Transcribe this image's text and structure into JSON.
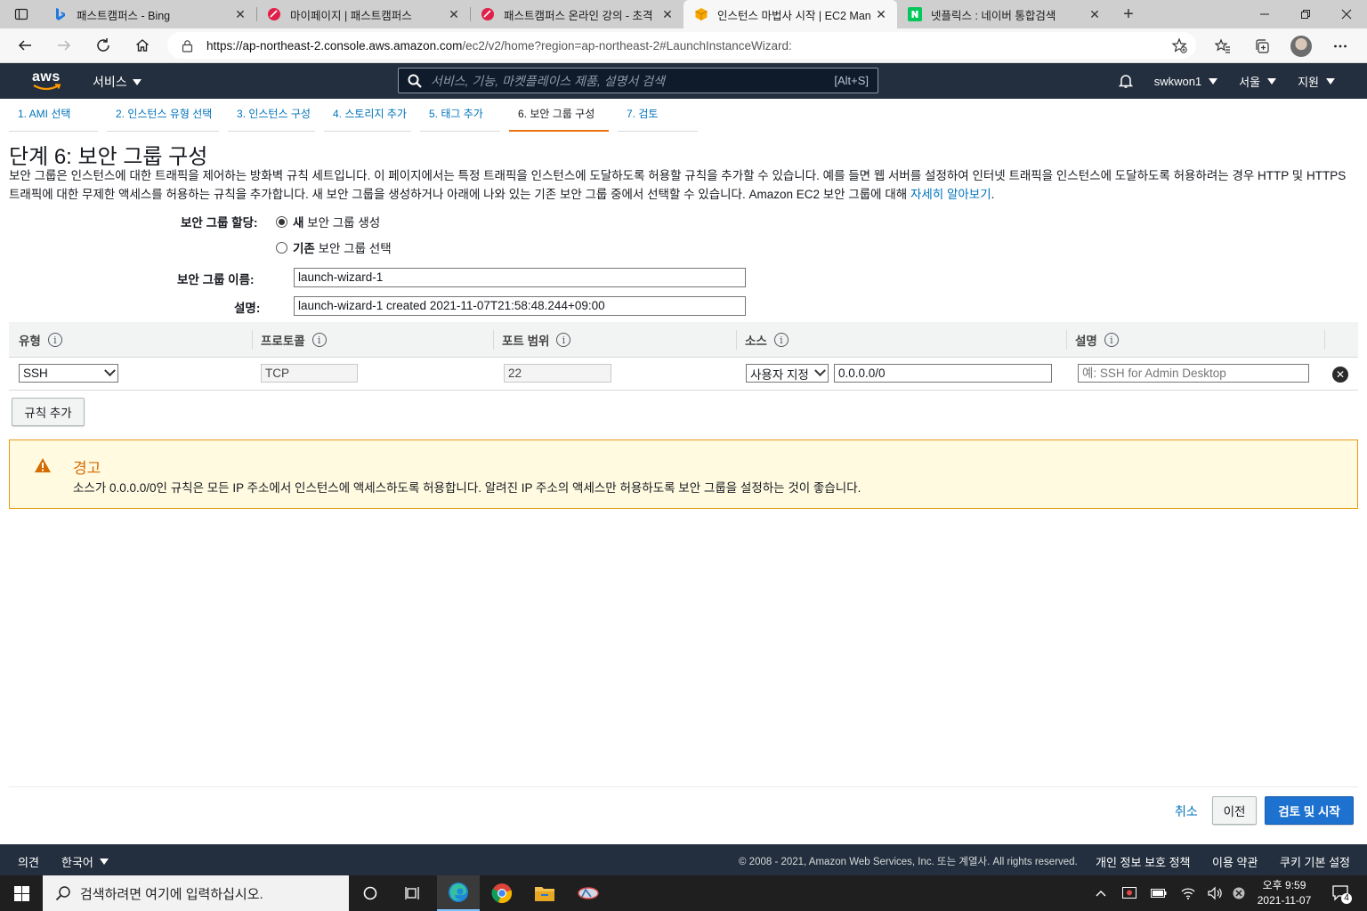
{
  "browser": {
    "tabs": [
      {
        "title": "패스트캠퍼스 - Bing",
        "favicon": "bing-icon",
        "active": false
      },
      {
        "title": "마이페이지 | 패스트캠퍼스",
        "favicon": "fastcampus-icon",
        "active": false
      },
      {
        "title": "패스트캠퍼스 온라인 강의 - 초격",
        "favicon": "fastcampus-icon",
        "active": false
      },
      {
        "title": "인스턴스 마법사 시작 | EC2 Man",
        "favicon": "aws-box-icon",
        "active": true
      },
      {
        "title": "넷플릭스 : 네이버 통합검색",
        "favicon": "naver-icon",
        "active": false
      }
    ],
    "close_glyph": "✕",
    "new_tab_glyph": "+",
    "url_host": "https://ap-northeast-2.console.aws.amazon.com",
    "url_path": "/ec2/v2/home?region=ap-northeast-2#LaunchInstanceWizard:"
  },
  "aws_header": {
    "logo_text": "aws",
    "services_label": "서비스",
    "search_placeholder": "서비스, 기능, 마켓플레이스 제품, 설명서 검색",
    "search_shortcut": "[Alt+S]",
    "user": "swkwon1",
    "region": "서울",
    "support": "지원"
  },
  "steps": [
    {
      "label": "1. AMI 선택",
      "active": false
    },
    {
      "label": "2. 인스턴스 유형 선택",
      "active": false
    },
    {
      "label": "3. 인스턴스 구성",
      "active": false
    },
    {
      "label": "4. 스토리지 추가",
      "active": false
    },
    {
      "label": "5. 태그 추가",
      "active": false
    },
    {
      "label": "6. 보안 그룹 구성",
      "active": true
    },
    {
      "label": "7. 검토",
      "active": false
    }
  ],
  "page": {
    "title": "단계 6: 보안 그룹 구성",
    "intro": "보안 그룹은 인스턴스에 대한 트래픽을 제어하는 방화벽 규칙 세트입니다. 이 페이지에서는 특정 트래픽을 인스턴스에 도달하도록 허용할 규칙을 추가할 수 있습니다. 예를 들면 웹 서버를 설정하여 인터넷 트래픽을 인스턴스에 도달하도록 허용하려는 경우 HTTP 및 HTTPS 트래픽에 대한 무제한 액세스를 허용하는 규칙을 추가합니다. 새 보안 그룹을 생성하거나 아래에 나와 있는 기존 보안 그룹 중에서 선택할 수 있습니다. Amazon EC2 보안 그룹에 대해 ",
    "learn_more": "자세히 알아보기",
    "intro_end": "."
  },
  "form": {
    "assign_label": "보안 그룹 할당:",
    "option_new_bold": "새",
    "option_new_rest": " 보안 그룹 생성",
    "option_existing_bold": "기존",
    "option_existing_rest": " 보안 그룹 선택",
    "selected_option": "new",
    "name_label": "보안 그룹 이름:",
    "name_value": "launch-wizard-1",
    "desc_label": "설명:",
    "desc_value": "launch-wizard-1 created 2021-11-07T21:58:48.244+09:00"
  },
  "rules_table": {
    "headers": [
      "유형",
      "프로토콜",
      "포트 범위",
      "소스",
      "설명"
    ],
    "info_glyph": "i",
    "rows": [
      {
        "type": "SSH",
        "protocol": "TCP",
        "port_range": "22",
        "source_mode": "사용자 지정",
        "source_cidr": "0.0.0.0/0",
        "description_placeholder": "예: SSH for Admin Desktop"
      }
    ],
    "remove_glyph": "✕",
    "add_rule_label": "규칙 추가"
  },
  "warning": {
    "title": "경고",
    "text": "소스가 0.0.0.0/0인 규칙은 모든 IP 주소에서 인스턴스에 액세스하도록 허용합니다. 알려진 IP 주소의 액세스만 허용하도록 보안 그룹을 설정하는 것이 좋습니다.",
    "color": "#e89b10"
  },
  "actions": {
    "cancel": "취소",
    "previous": "이전",
    "review_launch": "검토 및 시작"
  },
  "footer": {
    "feedback": "의견",
    "language": "한국어",
    "copyright": "© 2008 - 2021, Amazon Web Services, Inc. 또는 계열사. All rights reserved.",
    "privacy": "개인 정보 보호 정책",
    "terms": "이용 약관",
    "cookies": "쿠키 기본 설정"
  },
  "taskbar": {
    "search_placeholder": "검색하려면 여기에 입력하십시오.",
    "time": "오후 9:59",
    "date": "2021-11-07",
    "notification_count": "4"
  },
  "colors": {
    "aws_nav": "#232f3e",
    "link": "#0073bb",
    "active_step": "#ec7211",
    "primary_button": "#1d72d0"
  }
}
